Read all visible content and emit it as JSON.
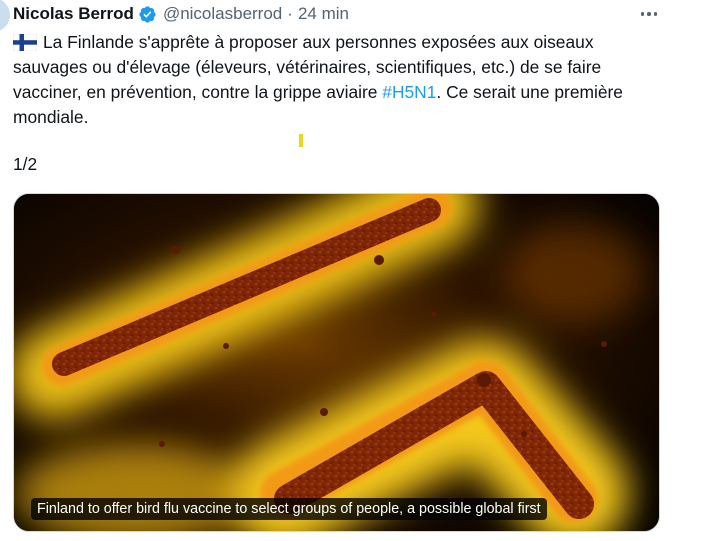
{
  "author": {
    "display_name": "Nicolas Berrod",
    "handle": "@nicolasberrod",
    "separator": "·",
    "time": "24 min",
    "verified_icon": "verified-badge-icon",
    "verified_color": "#1d9bf0"
  },
  "tweet": {
    "flag_icon": "finland-flag-emoji",
    "text_before_hashtag": "La Finlande s'apprête à proposer aux personnes exposées aux oiseaux sauvages ou d'élevage (éleveurs, vétérinaires, scientifiques, etc.) de se faire vacciner, en prévention, contre la grippe aviaire ",
    "hashtag": "#H5N1",
    "text_after_hashtag": ". Ce serait une première mondiale.",
    "thread_counter": "1/2"
  },
  "media": {
    "caption": "Finland to offer bird flu vaccine to select groups of people, a possible global first"
  },
  "colors": {
    "text": "#0f1419",
    "secondary": "#536471",
    "link": "#1d9bf0"
  }
}
